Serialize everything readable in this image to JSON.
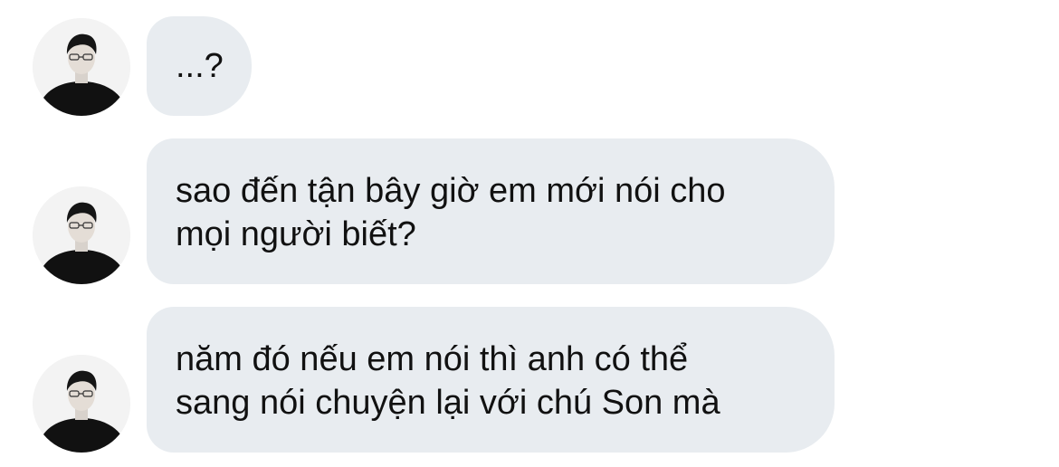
{
  "chat": {
    "messages": [
      {
        "sender_avatar": "profile-photo",
        "text": "...?"
      },
      {
        "sender_avatar": "profile-photo",
        "text": "sao đến tận bây giờ em mới nói cho\nmọi người biết?"
      },
      {
        "sender_avatar": "profile-photo",
        "text": "năm đó nếu em nói thì anh có thể\nsang nói chuyện lại với chú Son mà"
      }
    ]
  },
  "colors": {
    "bubble_background": "#e8ecf0",
    "text": "#111111",
    "page_background": "#ffffff"
  }
}
